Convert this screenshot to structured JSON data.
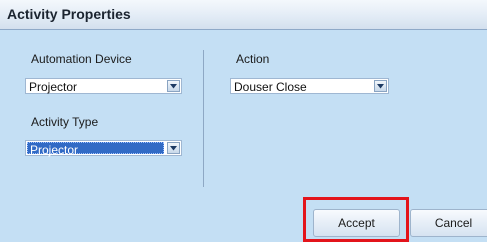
{
  "window": {
    "title": "Activity Properties"
  },
  "form": {
    "automation_device": {
      "label": "Automation Device",
      "value": "Projector"
    },
    "activity_type": {
      "label": "Activity Type",
      "value": "Projector"
    },
    "action": {
      "label": "Action",
      "value": "Douser Close"
    }
  },
  "buttons": {
    "accept": "Accept",
    "cancel": "Cancel"
  },
  "colors": {
    "dialog_bg": "#c4dff4",
    "selection": "#316ac5",
    "highlight": "#e3141b"
  },
  "icons": {
    "dropdown_arrow": "chevron-down-icon"
  }
}
